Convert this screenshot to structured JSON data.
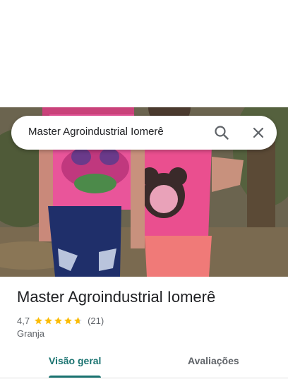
{
  "search": {
    "query": "Master Agroindustrial Iomerê"
  },
  "place": {
    "name": "Master Agroindustrial Iomerê",
    "rating": "4,7",
    "rating_fraction": 0.94,
    "review_count": "(21)",
    "category": "Granja"
  },
  "tabs": [
    {
      "label": "Visão geral",
      "active": true
    },
    {
      "label": "Avaliações",
      "active": false
    }
  ],
  "icons": {
    "search": "search-icon",
    "close": "close-icon",
    "star": "star-icon"
  },
  "colors": {
    "accent": "#1a7370",
    "star": "#fbbc04",
    "star_empty": "#dadce0"
  }
}
